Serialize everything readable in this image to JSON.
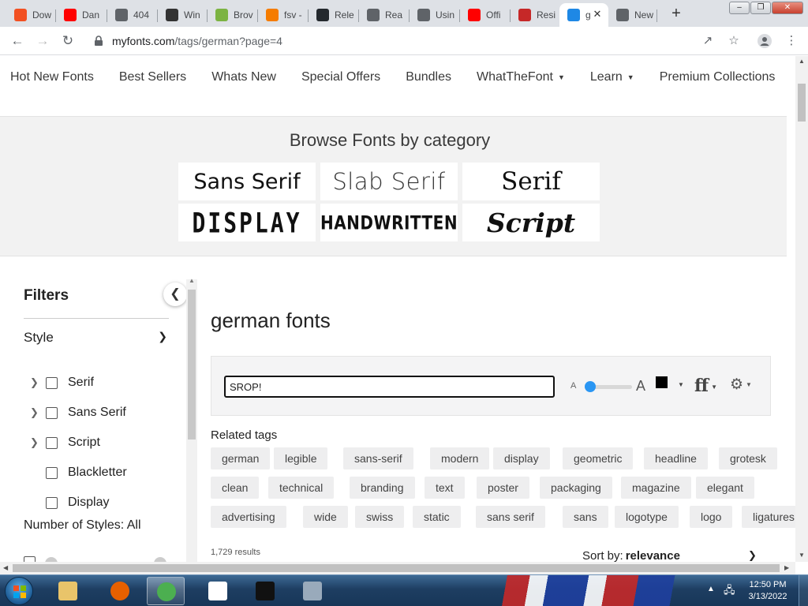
{
  "browser": {
    "tabs": [
      {
        "title": "Dow",
        "icon": "windows-icon",
        "color": "#f25022"
      },
      {
        "title": "Dan",
        "icon": "youtube-icon",
        "color": "#ff0000"
      },
      {
        "title": "404",
        "icon": "globe-icon",
        "color": "#5f6368"
      },
      {
        "title": "Win",
        "icon": "wikipedia-icon",
        "color": "#333333"
      },
      {
        "title": "Brov",
        "icon": "bookmark-icon",
        "color": "#7cb342"
      },
      {
        "title": "fsv -",
        "icon": "code-icon",
        "color": "#f57c00"
      },
      {
        "title": "Rele",
        "icon": "github-icon",
        "color": "#24292e"
      },
      {
        "title": "Rea",
        "icon": "globe-icon",
        "color": "#5f6368"
      },
      {
        "title": "Usin",
        "icon": "globe-icon",
        "color": "#5f6368"
      },
      {
        "title": "Offi",
        "icon": "youtube-icon",
        "color": "#ff0000"
      },
      {
        "title": "Resi",
        "icon": "cube-icon",
        "color": "#c62828"
      },
      {
        "title": "g",
        "icon": "myfonts-icon",
        "color": "#1e88e5"
      },
      {
        "title": "New",
        "icon": "chrome-icon",
        "color": "#5f6368"
      }
    ],
    "url_host": "myfonts.com",
    "url_path": "/tags/german?page=4"
  },
  "nav": {
    "items": [
      "Hot New Fonts",
      "Best Sellers",
      "Whats New",
      "Special Offers",
      "Bundles",
      "WhatTheFont",
      "Learn",
      "Premium Collections"
    ]
  },
  "browse": {
    "title": "Browse Fonts by category",
    "categories": [
      "Sans Serif",
      "Slab Serif",
      "Serif",
      "DISPLAY",
      "HANDWRITTEN",
      "Script"
    ]
  },
  "filters": {
    "title": "Filters",
    "style_label": "Style",
    "options": [
      "Serif",
      "Sans Serif",
      "Script",
      "Blackletter",
      "Display"
    ],
    "num_styles_label": "Number of Styles: All"
  },
  "main": {
    "title": "german fonts",
    "preview_text": "SROP!",
    "size_small": "A",
    "size_large": "A",
    "ligature_glyph": "ff",
    "related_label": "Related tags",
    "tags": [
      [
        "german",
        "legible",
        "sans-serif",
        "modern",
        "display",
        "geometric",
        "headline",
        "grotesk"
      ],
      [
        "clean",
        "technical",
        "branding",
        "text",
        "poster",
        "packaging",
        "magazine",
        "elegant"
      ],
      [
        "advertising",
        "wide",
        "swiss",
        "static",
        "sans serif",
        "sans",
        "logotype",
        "logo",
        "ligatures"
      ]
    ],
    "results": "1,729 results",
    "sort_label": "Sort by:",
    "sort_value": "relevance"
  },
  "taskbar": {
    "apps": [
      {
        "name": "explorer",
        "icon": "folder-icon",
        "color": "#e9c46a"
      },
      {
        "name": "firefox",
        "icon": "firefox-icon",
        "color": "#e66000"
      },
      {
        "name": "chrome",
        "icon": "chrome-icon",
        "color": "#4caf50"
      },
      {
        "name": "7zip",
        "icon": "7zip-icon",
        "color": "#ffffff"
      },
      {
        "name": "cmd",
        "icon": "terminal-icon",
        "color": "#111111"
      },
      {
        "name": "monitor",
        "icon": "monitor-icon",
        "color": "#9ab"
      }
    ],
    "time": "12:50 PM",
    "date": "3/13/2022"
  }
}
